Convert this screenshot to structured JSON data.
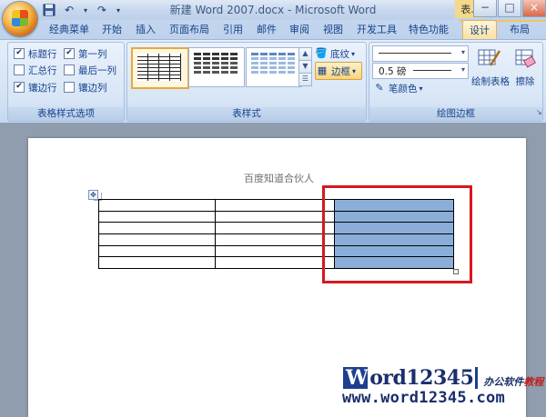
{
  "window": {
    "title": "新建 Word 2007.docx - Microsoft Word",
    "context_tab": "表...",
    "controls": [
      "−",
      "□",
      "×"
    ]
  },
  "quick_access": {
    "save_icon": "save-icon",
    "undo_icon": "undo-icon",
    "redo_icon": "redo-icon"
  },
  "tabs": [
    {
      "label": "经典菜单"
    },
    {
      "label": "开始"
    },
    {
      "label": "插入"
    },
    {
      "label": "页面布局"
    },
    {
      "label": "引用"
    },
    {
      "label": "邮件"
    },
    {
      "label": "审阅"
    },
    {
      "label": "视图"
    },
    {
      "label": "开发工具"
    },
    {
      "label": "特色功能"
    },
    {
      "label": "设计",
      "active": true
    },
    {
      "label": "布局"
    }
  ],
  "ribbon": {
    "table_style_options": {
      "label": "表格样式选项",
      "options": [
        {
          "label": "标题行",
          "checked": true
        },
        {
          "label": "第一列",
          "checked": true
        },
        {
          "label": "汇总行",
          "checked": false
        },
        {
          "label": "最后一列",
          "checked": false
        },
        {
          "label": "镶边行",
          "checked": true
        },
        {
          "label": "镶边列",
          "checked": false
        }
      ]
    },
    "table_styles": {
      "label": "表样式",
      "shading": "底纹",
      "borders": "边框"
    },
    "draw_borders": {
      "label": "绘图边框",
      "line_weight": "0.5 磅",
      "pen_color": "笔颜色",
      "draw_table": "绘制表格",
      "eraser": "擦除"
    }
  },
  "document": {
    "heading": "百度知道合伙人",
    "table_rows": 6,
    "table_cols": 3,
    "selected_column_color": "#8aaed8",
    "highlight_color": "#d7191f"
  },
  "watermark": {
    "logo_w": "W",
    "logo_rest": "ord12345",
    "tag_main": "办公软件",
    "tag_red": "教程",
    "url": "www.word12345.com"
  }
}
